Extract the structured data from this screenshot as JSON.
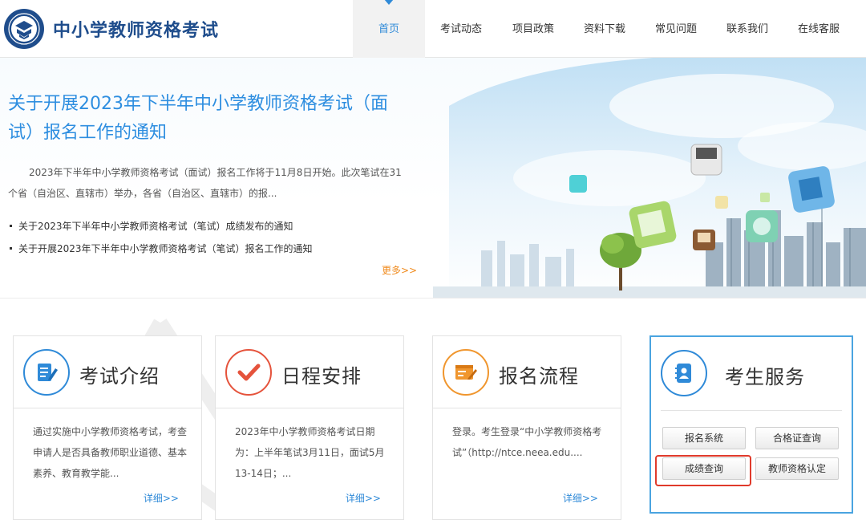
{
  "header": {
    "site_title": "中小学教师资格考试",
    "nav": [
      "首页",
      "考试动态",
      "项目政策",
      "资料下载",
      "常见问题",
      "联系我们",
      "在线客服"
    ],
    "active_index": 0
  },
  "banner": {
    "headline": "关于开展2023年下半年中小学教师资格考试（面试）报名工作的通知",
    "summary": "2023年下半年中小学教师资格考试（面试）报名工作将于11月8日开始。此次笔试在31个省（自治区、直辖市）举办，各省（自治区、直辖市）的报...",
    "news": [
      "关于2023年下半年中小学教师资格考试（笔试）成绩发布的通知",
      "关于开展2023年下半年中小学教师资格考试（笔试）报名工作的通知"
    ],
    "more_label": "更多>>"
  },
  "cards": [
    {
      "title": "考试介绍",
      "text": "通过实施中小学教师资格考试，考查申请人是否具备教师职业道德、基本素养、教育教学能...",
      "more": "详细>>",
      "icon": "document-edit-icon",
      "color": "#2f8ad8"
    },
    {
      "title": "日程安排",
      "text": "2023年中小学教师资格考试日期为：上半年笔试3月11日，面试5月13-14日；...",
      "more": "详细>>",
      "icon": "checkmark-icon",
      "color": "#e5533c"
    },
    {
      "title": "报名流程",
      "text": "登录。考生登录“中小学教师资格考试”（http://ntce.neea.edu....",
      "more": "详细>>",
      "icon": "form-edit-icon",
      "color": "#f0962e"
    }
  ],
  "service": {
    "title": "考生服务",
    "icon": "contact-book-icon",
    "color": "#2f8ad8",
    "buttons": [
      "报名系统",
      "合格证查询",
      "成绩查询",
      "教师资格认定"
    ],
    "highlighted": "成绩查询",
    "highlight_color": "#e03a2b"
  }
}
